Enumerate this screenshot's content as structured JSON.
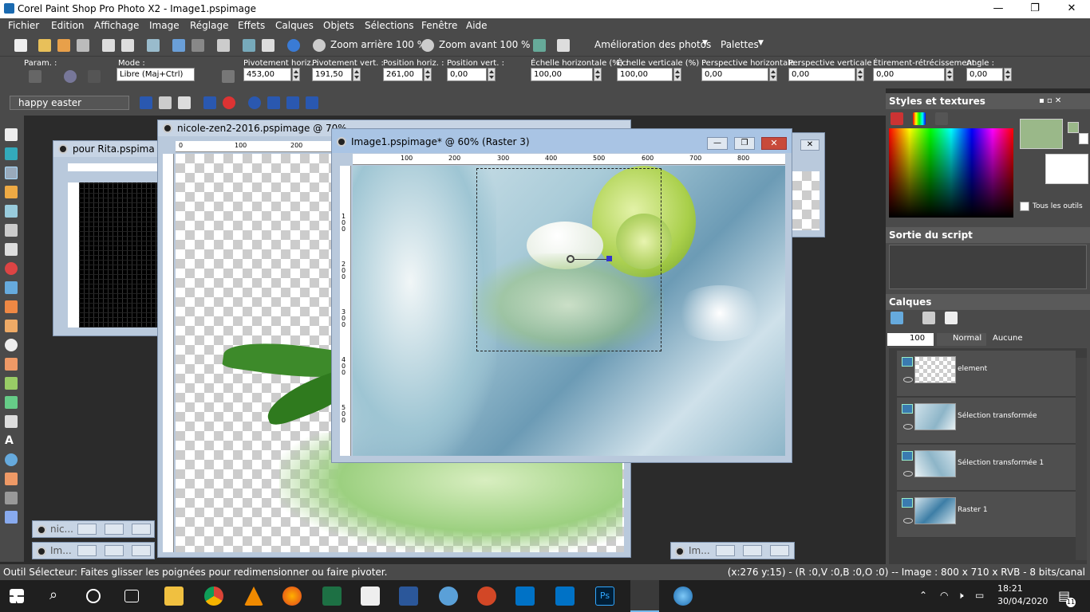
{
  "app": {
    "title": "Corel Paint Shop Pro Photo X2 - Image1.pspimage"
  },
  "menu": [
    "Fichier",
    "Edition",
    "Affichage",
    "Image",
    "Réglage",
    "Effets",
    "Calques",
    "Objets",
    "Sélections",
    "Fenêtre",
    "Aide"
  ],
  "toolbar": {
    "zoom_out": "Zoom arrière 100 %",
    "zoom_in": "Zoom avant 100 %",
    "enhance": "Amélioration des photos",
    "palettes": "Palettes"
  },
  "tool_options": {
    "param": "Param. :",
    "mode_label": "Mode :",
    "mode_value": "Libre (Maj+Ctrl)",
    "fields": [
      {
        "label": "Pivotement horiz. :",
        "value": "453,00"
      },
      {
        "label": "Pivotement vert. :",
        "value": "191,50"
      },
      {
        "label": "Position horiz. :",
        "value": "261,00"
      },
      {
        "label": "Position vert. :",
        "value": "0,00"
      },
      {
        "label": "Échelle horizontale (%) :",
        "value": "100,00"
      },
      {
        "label": "Échelle verticale (%) :",
        "value": "100,00"
      },
      {
        "label": "Perspective horizontale :",
        "value": "0,00"
      },
      {
        "label": "Perspective verticale :",
        "value": "0,00"
      },
      {
        "label": "Étirement-rétrécissement :",
        "value": "0,00"
      },
      {
        "label": "Angle :",
        "value": "0,00"
      }
    ]
  },
  "script": {
    "name": "happy easter"
  },
  "windows": {
    "rita": "pour Rita.pspima",
    "nicole": "nicole-zen2-2016.pspimage @  70%",
    "image1": "Image1.pspimage* @  60% (Raster 3)"
  },
  "rulers": {
    "nicole_h": [
      "0",
      "100",
      "200"
    ],
    "image1_h": [
      "100",
      "200",
      "300",
      "400",
      "500",
      "600",
      "700",
      "800"
    ],
    "image1_v": [
      "1\n0\n0",
      "2\n0\n0",
      "3\n0\n0",
      "4\n0\n0",
      "5\n0\n0"
    ]
  },
  "minimized": [
    {
      "title": "nic..."
    },
    {
      "title": "Im..."
    },
    {
      "title": "Im..."
    }
  ],
  "panels": {
    "styles": "Styles et textures",
    "all_tools": "Tous les outils",
    "script_output": "Sortie du script",
    "layers": "Calques",
    "opacity": "100",
    "blend": "Normal",
    "mask": "Aucune",
    "layer_list": [
      "element",
      "Sélection transformée",
      "Sélection transformée 1",
      "Raster 1"
    ]
  },
  "status": {
    "left": "Outil Sélecteur: Faites glisser les poignées pour redimensionner ou faire pivoter.",
    "right": "(x:276 y:15) - (R :0,V :0,B :0,O :0) -- Image : 800 x 710 x RVB - 8 bits/canal"
  },
  "taskbar": {
    "time": "18:21",
    "date": "30/04/2020",
    "badge": "11"
  },
  "colors": {
    "foreground": "#9ab889",
    "background": "#ffffff"
  }
}
